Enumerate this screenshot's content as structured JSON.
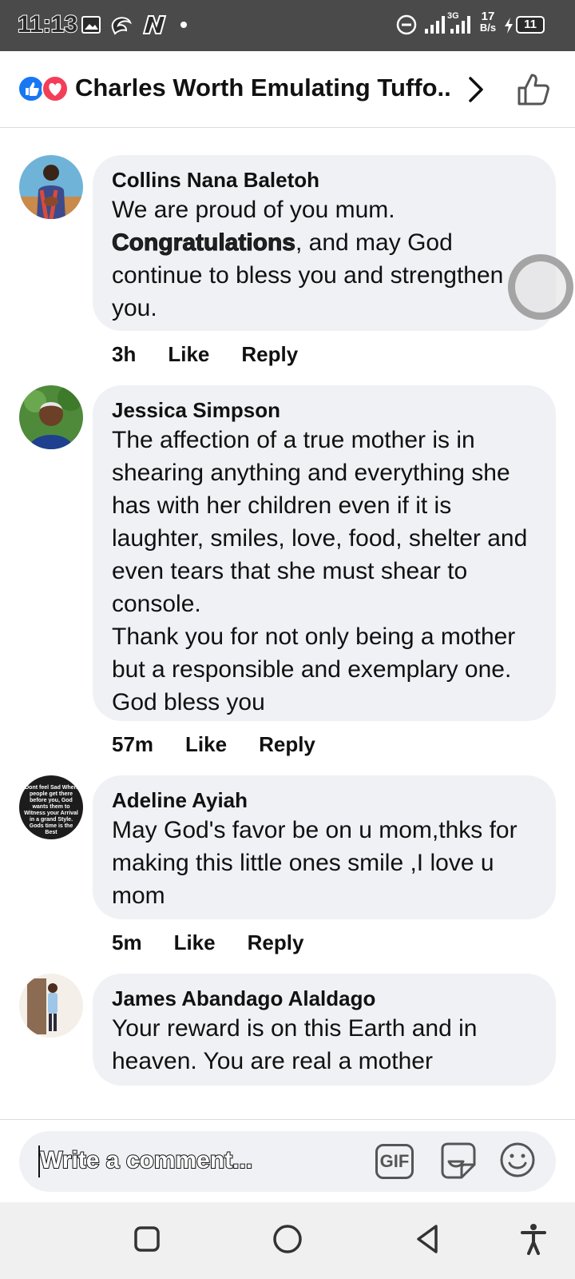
{
  "status_bar": {
    "time": "11:13",
    "network": "3G",
    "speed_value": "17",
    "speed_unit": "B/s",
    "battery": "11"
  },
  "header": {
    "title": "Charles Worth Emulating Tuffo...",
    "icons": [
      "like-reaction-icon",
      "love-reaction-icon",
      "chevron-right-icon",
      "thumbs-up-icon"
    ]
  },
  "comments": [
    {
      "author": "Collins Nana Baletoh",
      "text_before": "We are proud of you mum.\n",
      "text_highlight": "Congratulations",
      "text_after": ", and may God continue to bless you and strengthen you.",
      "time": "3h",
      "like": "Like",
      "reply": "Reply"
    },
    {
      "author": "Jessica Simpson",
      "text": "The affection of a true mother is in shearing anything and everything she has with her children even if it is laughter, smiles, love, food, shelter and even tears that she must shear to console.\nThank you for not only being a mother but a responsible and exemplary one. God bless you",
      "time": "57m",
      "like": "Like",
      "reply": "Reply"
    },
    {
      "author": "Adeline Ayiah",
      "avatar_text": "Dont feel Sad When people get there before you, God wants them to Witness your Arrival in a grand Style. Gods time is the Best",
      "text": "May God's favor be  on u mom,thks for making this little ones smile ,I love u mom",
      "time": "5m",
      "like": "Like",
      "reply": "Reply"
    },
    {
      "author": "James Abandago Alaldago",
      "text": "Your reward is on this Earth and in heaven. You are real a mother"
    }
  ],
  "composer": {
    "placeholder": "Write a comment...",
    "gif_label": "GIF"
  },
  "colors": {
    "bubble_bg": "#f0f1f5",
    "like_blue": "#1877f2",
    "love_red": "#f33e58",
    "status_bar_bg": "#4a4a4a"
  }
}
